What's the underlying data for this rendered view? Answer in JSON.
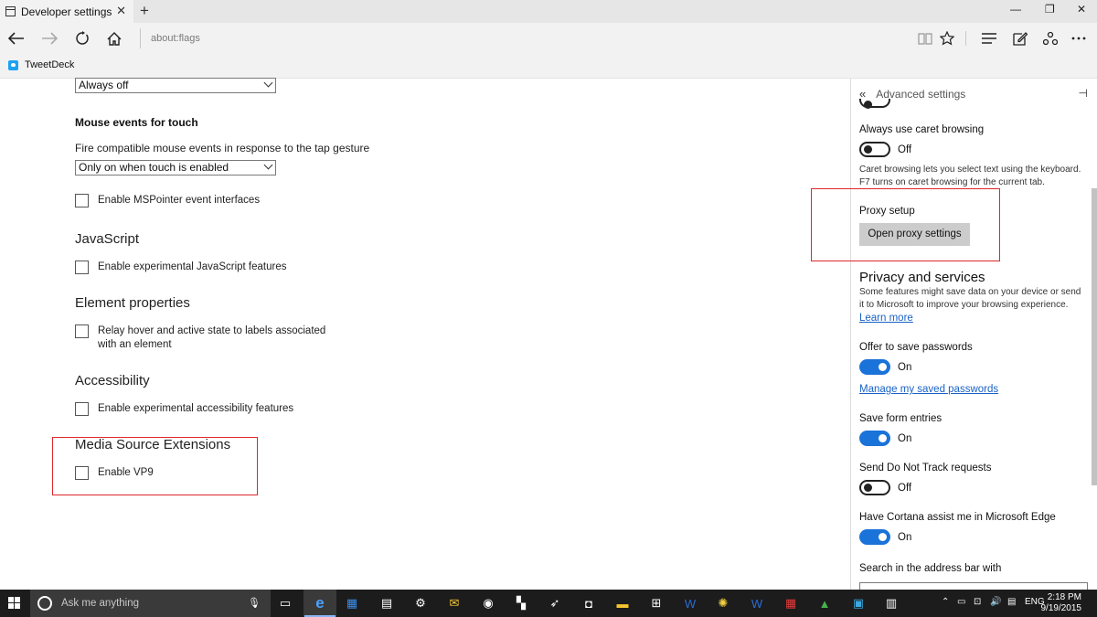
{
  "tab": {
    "title": "Developer settings",
    "close": "✕",
    "new_tab": "+"
  },
  "window_controls": {
    "minimize": "—",
    "maximize": "❐",
    "close": "✕"
  },
  "address": {
    "url": "about:flags"
  },
  "favorites": [
    {
      "label": "TweetDeck",
      "icon": "tweetdeck-icon"
    }
  ],
  "flags": {
    "top_select_value": "Always off",
    "mouse_events": {
      "heading": "Mouse events for touch",
      "description": "Fire compatible mouse events in response to the tap gesture",
      "select_value": "Only on when touch is enabled",
      "checkbox_label": "Enable MSPointer event interfaces"
    },
    "javascript": {
      "heading": "JavaScript",
      "checkbox_label": "Enable experimental JavaScript features"
    },
    "element_properties": {
      "heading": "Element properties",
      "checkbox_label": "Relay hover and active state to labels associated with an element"
    },
    "accessibility": {
      "heading": "Accessibility",
      "checkbox_label": "Enable experimental accessibility features"
    },
    "media_source": {
      "heading": "Media Source Extensions",
      "checkbox_label": "Enable VP9"
    }
  },
  "pane": {
    "title": "Advanced settings",
    "back_glyph": "«",
    "pin_glyph": "⊣",
    "caret": {
      "label": "Always use caret browsing",
      "state": "Off",
      "description": "Caret browsing lets you select text using the keyboard. F7 turns on caret browsing for the current tab."
    },
    "proxy": {
      "label": "Proxy setup",
      "button": "Open proxy settings"
    },
    "privacy": {
      "heading": "Privacy and services",
      "description": "Some features might save data on your device or send it to Microsoft to improve your browsing experience.",
      "learn_more": "Learn more"
    },
    "passwords": {
      "label": "Offer to save passwords",
      "state": "On",
      "manage_link": "Manage my saved passwords"
    },
    "form_entries": {
      "label": "Save form entries",
      "state": "On"
    },
    "dnt": {
      "label": "Send Do Not Track requests",
      "state": "Off"
    },
    "cortana": {
      "label": "Have Cortana assist me in Microsoft Edge",
      "state": "On"
    },
    "search": {
      "label": "Search in the address bar with"
    }
  },
  "taskbar": {
    "search_placeholder": "Ask me anything",
    "language": "ENG",
    "time": "2:18 PM",
    "date": "9/19/2015"
  },
  "colors": {
    "accent": "#1a73d8",
    "highlight_box": "#e0262b",
    "taskbar": "#1c1c1c",
    "link": "#1a62c6"
  }
}
